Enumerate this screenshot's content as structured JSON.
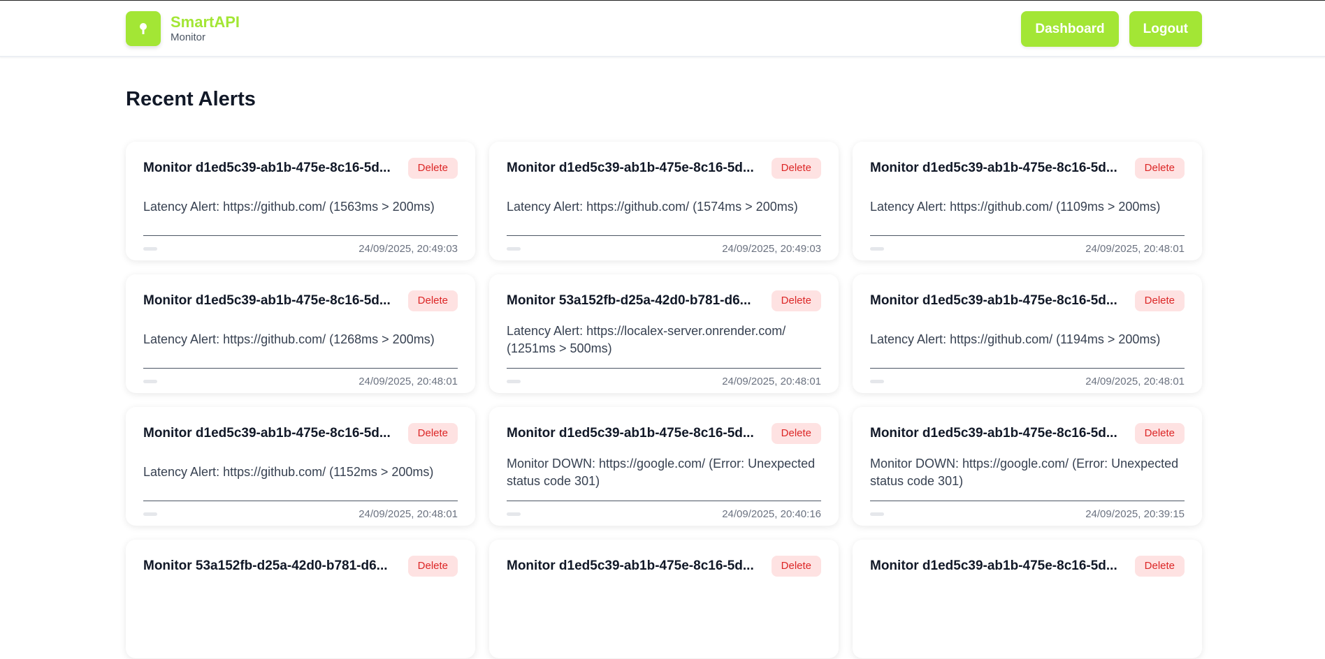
{
  "brand": {
    "name": "SmartAPI",
    "subtitle": "Monitor",
    "icon": "key-icon"
  },
  "nav": {
    "dashboard_label": "Dashboard",
    "logout_label": "Logout"
  },
  "page": {
    "title": "Recent Alerts"
  },
  "delete_label": "Delete",
  "alerts": [
    {
      "title": "Monitor d1ed5c39-ab1b-475e-8c16-5d...",
      "message": "Latency Alert: https://github.com/ (1563ms > 200ms)",
      "time": "24/09/2025, 20:49:03"
    },
    {
      "title": "Monitor d1ed5c39-ab1b-475e-8c16-5d...",
      "message": "Latency Alert: https://github.com/ (1574ms > 200ms)",
      "time": "24/09/2025, 20:49:03"
    },
    {
      "title": "Monitor d1ed5c39-ab1b-475e-8c16-5d...",
      "message": "Latency Alert: https://github.com/ (1109ms > 200ms)",
      "time": "24/09/2025, 20:48:01"
    },
    {
      "title": "Monitor d1ed5c39-ab1b-475e-8c16-5d...",
      "message": "Latency Alert: https://github.com/ (1268ms > 200ms)",
      "time": "24/09/2025, 20:48:01"
    },
    {
      "title": "Monitor 53a152fb-d25a-42d0-b781-d6...",
      "message": "Latency Alert: https://localex-server.onrender.com/ (1251ms > 500ms)",
      "time": "24/09/2025, 20:48:01"
    },
    {
      "title": "Monitor d1ed5c39-ab1b-475e-8c16-5d...",
      "message": "Latency Alert: https://github.com/ (1194ms > 200ms)",
      "time": "24/09/2025, 20:48:01"
    },
    {
      "title": "Monitor d1ed5c39-ab1b-475e-8c16-5d...",
      "message": "Latency Alert: https://github.com/ (1152ms > 200ms)",
      "time": "24/09/2025, 20:48:01"
    },
    {
      "title": "Monitor d1ed5c39-ab1b-475e-8c16-5d...",
      "message": "Monitor DOWN: https://google.com/ (Error: Unexpected status code 301)",
      "time": "24/09/2025, 20:40:16"
    },
    {
      "title": "Monitor d1ed5c39-ab1b-475e-8c16-5d...",
      "message": "Monitor DOWN: https://google.com/ (Error: Unexpected status code 301)",
      "time": "24/09/2025, 20:39:15"
    },
    {
      "title": "Monitor 53a152fb-d25a-42d0-b781-d6...",
      "message": "",
      "time": ""
    },
    {
      "title": "Monitor d1ed5c39-ab1b-475e-8c16-5d...",
      "message": "",
      "time": ""
    },
    {
      "title": "Monitor d1ed5c39-ab1b-475e-8c16-5d...",
      "message": "",
      "time": ""
    }
  ],
  "colors": {
    "accent": "#a3e635",
    "delete_bg": "#fee2e2",
    "delete_text": "#dc2626",
    "heading": "#111827"
  }
}
